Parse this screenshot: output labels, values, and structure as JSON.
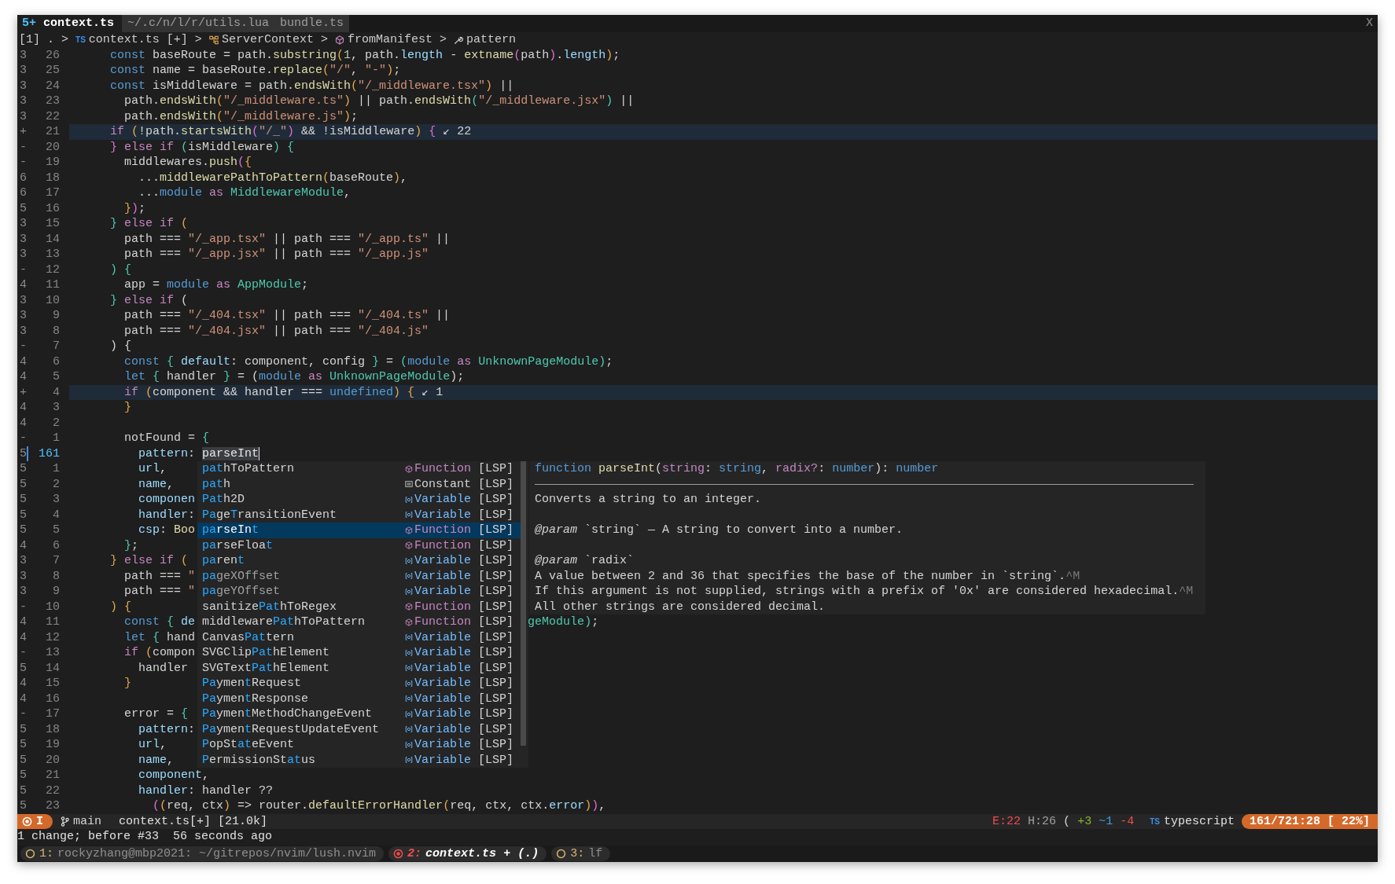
{
  "tabs": [
    {
      "badge": "5+",
      "label": "context.ts",
      "selected": true
    },
    {
      "label": "~/.c/n/l/r/utils.lua",
      "selected": false
    },
    {
      "label": "bundle.ts",
      "selected": false
    }
  ],
  "close_label": "X",
  "breadcrumb": [
    {
      "text": "[1]",
      "kind": "text"
    },
    {
      "text": ".",
      "kind": "text"
    },
    {
      "text": ">",
      "kind": "sep"
    },
    {
      "text": "context.ts [+]",
      "kind": "file",
      "icon_text": "TS"
    },
    {
      "text": ">",
      "kind": "sep"
    },
    {
      "text": "ServerContext",
      "kind": "class"
    },
    {
      "text": ">",
      "kind": "sep"
    },
    {
      "text": "fromManifest",
      "kind": "method"
    },
    {
      "text": ">",
      "kind": "sep"
    },
    {
      "text": "pattern",
      "kind": "property"
    }
  ],
  "editor": {
    "lines": [
      {
        "sign": "3",
        "number": "26",
        "highlighted": false,
        "current": false,
        "code": [
          {
            "text": "    const",
            "kind": "decl"
          },
          {
            "text": " baseRoute = path.",
            "kind": "x"
          },
          {
            "text": "substring",
            "kind": "fn"
          },
          {
            "text": "(",
            "kind": "b1"
          },
          {
            "text": "1",
            "kind": "num"
          },
          {
            "text": ", path.",
            "kind": "x"
          },
          {
            "text": "length",
            "kind": "prop"
          },
          {
            "text": " - ",
            "kind": "x"
          },
          {
            "text": "extname",
            "kind": "fn"
          },
          {
            "text": "(",
            "kind": "b2"
          },
          {
            "text": "path",
            "kind": "x"
          },
          {
            "text": ")",
            "kind": "b2"
          },
          {
            "text": ".",
            "kind": "x"
          },
          {
            "text": "length",
            "kind": "prop"
          },
          {
            "text": ")",
            "kind": "b1"
          },
          {
            "text": ";",
            "kind": "x"
          }
        ]
      },
      {
        "sign": "3",
        "number": "25",
        "highlighted": false,
        "current": false,
        "code": [
          {
            "text": "    const",
            "kind": "decl"
          },
          {
            "text": " name = baseRoute.",
            "kind": "x"
          },
          {
            "text": "replace",
            "kind": "fn"
          },
          {
            "text": "(",
            "kind": "b1"
          },
          {
            "text": "\"/\"",
            "kind": "str"
          },
          {
            "text": ", ",
            "kind": "x"
          },
          {
            "text": "\"-\"",
            "kind": "str"
          },
          {
            "text": ")",
            "kind": "b1"
          },
          {
            "text": ";",
            "kind": "x"
          }
        ]
      },
      {
        "sign": "3",
        "number": "24",
        "highlighted": false,
        "current": false,
        "code": [
          {
            "text": "    const",
            "kind": "decl"
          },
          {
            "text": " isMiddleware = path.",
            "kind": "x"
          },
          {
            "text": "endsWith",
            "kind": "fn"
          },
          {
            "text": "(",
            "kind": "b1"
          },
          {
            "text": "\"/_middleware.tsx\"",
            "kind": "str"
          },
          {
            "text": ")",
            "kind": "b1"
          },
          {
            "text": " ||",
            "kind": "x"
          }
        ]
      },
      {
        "sign": "3",
        "number": "23",
        "highlighted": false,
        "current": false,
        "code": [
          {
            "text": "      path.",
            "kind": "x"
          },
          {
            "text": "endsWith",
            "kind": "fn"
          },
          {
            "text": "(",
            "kind": "b1"
          },
          {
            "text": "\"/_middleware.ts\"",
            "kind": "str"
          },
          {
            "text": ")",
            "kind": "b1"
          },
          {
            "text": " || path.",
            "kind": "x"
          },
          {
            "text": "endsWith",
            "kind": "fn"
          },
          {
            "text": "(",
            "kind": "b3"
          },
          {
            "text": "\"/_middleware.jsx\"",
            "kind": "str"
          },
          {
            "text": ")",
            "kind": "b3"
          },
          {
            "text": " ||",
            "kind": "x"
          }
        ]
      },
      {
        "sign": "3",
        "number": "22",
        "highlighted": false,
        "current": false,
        "code": [
          {
            "text": "      path.",
            "kind": "x"
          },
          {
            "text": "endsWith",
            "kind": "fn"
          },
          {
            "text": "(",
            "kind": "b1"
          },
          {
            "text": "\"/_middleware.js\"",
            "kind": "str"
          },
          {
            "text": ")",
            "kind": "b1"
          },
          {
            "text": ";",
            "kind": "x"
          }
        ]
      },
      {
        "sign": "+",
        "number": "21",
        "highlighted": true,
        "current": false,
        "code": [
          {
            "text": "    if",
            "kind": "kw"
          },
          {
            "text": " (",
            "kind": "b1"
          },
          {
            "text": "!path.",
            "kind": "x"
          },
          {
            "text": "startsWith",
            "kind": "fn"
          },
          {
            "text": "(",
            "kind": "b2"
          },
          {
            "text": "\"/_\"",
            "kind": "str"
          },
          {
            "text": ")",
            "kind": "b2"
          },
          {
            "text": " && !isMiddleware",
            "kind": "x"
          },
          {
            "text": ")",
            "kind": "b1"
          },
          {
            "text": " {",
            "kind": "b2"
          }
        ],
        "virtual_text": "↙ 22"
      },
      {
        "sign": "-",
        "number": "20",
        "highlighted": false,
        "current": false,
        "code": [
          {
            "text": "    }",
            "kind": "b2"
          },
          {
            "text": " else if ",
            "kind": "kw"
          },
          {
            "text": "(",
            "kind": "b3"
          },
          {
            "text": "isMiddleware",
            "kind": "x"
          },
          {
            "text": ")",
            "kind": "b3"
          },
          {
            "text": " {",
            "kind": "b3"
          }
        ]
      },
      {
        "sign": "-",
        "number": "19",
        "highlighted": false,
        "current": false,
        "code": [
          {
            "text": "      middlewares.",
            "kind": "x"
          },
          {
            "text": "push",
            "kind": "fn"
          },
          {
            "text": "(",
            "kind": "b2"
          },
          {
            "text": "{",
            "kind": "b1"
          }
        ]
      },
      {
        "sign": "6",
        "number": "18",
        "highlighted": false,
        "current": false,
        "code": [
          {
            "text": "        ...",
            "kind": "x"
          },
          {
            "text": "middlewarePathToPattern",
            "kind": "fn"
          },
          {
            "text": "(",
            "kind": "b1"
          },
          {
            "text": "baseRoute",
            "kind": "x"
          },
          {
            "text": ")",
            "kind": "b1"
          },
          {
            "text": ",",
            "kind": "x"
          }
        ]
      },
      {
        "sign": "6",
        "number": "17",
        "highlighted": false,
        "current": false,
        "code": [
          {
            "text": "        ...",
            "kind": "x"
          },
          {
            "text": "module",
            "kind": "decl"
          },
          {
            "text": " as ",
            "kind": "kw"
          },
          {
            "text": "MiddlewareModule",
            "kind": "type"
          },
          {
            "text": ",",
            "kind": "x"
          }
        ]
      },
      {
        "sign": "5",
        "number": "16",
        "highlighted": false,
        "current": false,
        "code": [
          {
            "text": "      }",
            "kind": "b1"
          },
          {
            "text": ")",
            "kind": "b2"
          },
          {
            "text": ";",
            "kind": "x"
          }
        ]
      },
      {
        "sign": "3",
        "number": "15",
        "highlighted": false,
        "current": false,
        "code": [
          {
            "text": "    }",
            "kind": "b3"
          },
          {
            "text": " else if ",
            "kind": "kw"
          },
          {
            "text": "(",
            "kind": "b1"
          }
        ]
      },
      {
        "sign": "3",
        "number": "14",
        "highlighted": false,
        "current": false,
        "code": [
          {
            "text": "      path === ",
            "kind": "x"
          },
          {
            "text": "\"/_app.tsx\"",
            "kind": "str"
          },
          {
            "text": " || path === ",
            "kind": "x"
          },
          {
            "text": "\"/_app.ts\"",
            "kind": "str"
          },
          {
            "text": " ||",
            "kind": "x"
          }
        ]
      },
      {
        "sign": "3",
        "number": "13",
        "highlighted": false,
        "current": false,
        "code": [
          {
            "text": "      path === ",
            "kind": "x"
          },
          {
            "text": "\"/_app.jsx\"",
            "kind": "str"
          },
          {
            "text": " || path === ",
            "kind": "x"
          },
          {
            "text": "\"/_app.js\"",
            "kind": "str"
          }
        ]
      },
      {
        "sign": "-",
        "number": "12",
        "highlighted": false,
        "current": false,
        "code": [
          {
            "text": "    )",
            "kind": "b3"
          },
          {
            "text": " {",
            "kind": "b3"
          }
        ]
      },
      {
        "sign": "4",
        "number": "11",
        "highlighted": false,
        "current": false,
        "code": [
          {
            "text": "      app = ",
            "kind": "x"
          },
          {
            "text": "module",
            "kind": "decl"
          },
          {
            "text": " as ",
            "kind": "kw"
          },
          {
            "text": "AppModule",
            "kind": "type"
          },
          {
            "text": ";",
            "kind": "x"
          }
        ]
      },
      {
        "sign": "3",
        "number": "10",
        "highlighted": false,
        "current": false,
        "code": [
          {
            "text": "    }",
            "kind": "b3"
          },
          {
            "text": " else if ",
            "kind": "kw"
          },
          {
            "text": "(",
            "kind": "x"
          }
        ]
      },
      {
        "sign": "3",
        "number": "9",
        "highlighted": false,
        "current": false,
        "code": [
          {
            "text": "      path === ",
            "kind": "x"
          },
          {
            "text": "\"/_404.tsx\"",
            "kind": "str"
          },
          {
            "text": " || path === ",
            "kind": "x"
          },
          {
            "text": "\"/_404.ts\"",
            "kind": "str"
          },
          {
            "text": " ||",
            "kind": "x"
          }
        ]
      },
      {
        "sign": "3",
        "number": "8",
        "highlighted": false,
        "current": false,
        "code": [
          {
            "text": "      path === ",
            "kind": "x"
          },
          {
            "text": "\"/_404.jsx\"",
            "kind": "str"
          },
          {
            "text": " || path === ",
            "kind": "x"
          },
          {
            "text": "\"/_404.js\"",
            "kind": "str"
          }
        ]
      },
      {
        "sign": "-",
        "number": "7",
        "highlighted": false,
        "current": false,
        "code": [
          {
            "text": "    ) {",
            "kind": "x"
          }
        ]
      },
      {
        "sign": "4",
        "number": "6",
        "highlighted": false,
        "current": false,
        "code": [
          {
            "text": "      const",
            "kind": "decl"
          },
          {
            "text": " {",
            "kind": "b3"
          },
          {
            "text": " default",
            "kind": "prop"
          },
          {
            "text": ": component, config ",
            "kind": "x"
          },
          {
            "text": "}",
            "kind": "b3"
          },
          {
            "text": " = ",
            "kind": "x"
          },
          {
            "text": "(",
            "kind": "b3"
          },
          {
            "text": "module",
            "kind": "decl"
          },
          {
            "text": " as ",
            "kind": "kw"
          },
          {
            "text": "UnknownPageModule",
            "kind": "type"
          },
          {
            "text": ")",
            "kind": "b3"
          },
          {
            "text": ";",
            "kind": "x"
          }
        ]
      },
      {
        "sign": "4",
        "number": "5",
        "highlighted": false,
        "current": false,
        "code": [
          {
            "text": "      let",
            "kind": "decl"
          },
          {
            "text": " {",
            "kind": "b3"
          },
          {
            "text": " handler ",
            "kind": "x"
          },
          {
            "text": "}",
            "kind": "b3"
          },
          {
            "text": " = (",
            "kind": "x"
          },
          {
            "text": "module",
            "kind": "decl"
          },
          {
            "text": " as ",
            "kind": "kw"
          },
          {
            "text": "UnknownPageModule",
            "kind": "type"
          },
          {
            "text": ");",
            "kind": "x"
          }
        ]
      },
      {
        "sign": "+",
        "number": "4",
        "highlighted": true,
        "current": false,
        "code": [
          {
            "text": "      if",
            "kind": "kw"
          },
          {
            "text": " (",
            "kind": "b1"
          },
          {
            "text": "component && handler === ",
            "kind": "x"
          },
          {
            "text": "undefined",
            "kind": "decl"
          },
          {
            "text": ")",
            "kind": "b1"
          },
          {
            "text": " {",
            "kind": "b1"
          }
        ],
        "virtual_text": "↙ 1"
      },
      {
        "sign": "4",
        "number": "3",
        "highlighted": false,
        "current": false,
        "code": [
          {
            "text": "      }",
            "kind": "b1"
          }
        ]
      },
      {
        "sign": "4",
        "number": "2",
        "highlighted": false,
        "current": false
      },
      {
        "sign": "-",
        "number": "1",
        "highlighted": false,
        "current": false,
        "code": [
          {
            "text": "      notFound = ",
            "kind": "x"
          },
          {
            "text": "{",
            "kind": "b3"
          }
        ]
      },
      {
        "sign": "5",
        "number": "161",
        "highlighted": false,
        "current": true,
        "code": [
          {
            "text": "        pattern",
            "kind": "prop"
          },
          {
            "text": ": ",
            "kind": "x"
          },
          {
            "text": "parseInt",
            "kind": "hl"
          }
        ]
      },
      {
        "sign": "5",
        "number": "1",
        "highlighted": false,
        "current": false,
        "code": [
          {
            "text": "        url",
            "kind": "prop"
          },
          {
            "text": ",",
            "kind": "x"
          }
        ]
      },
      {
        "sign": "5",
        "number": "2",
        "highlighted": false,
        "current": false,
        "code": [
          {
            "text": "        name",
            "kind": "prop"
          },
          {
            "text": ",",
            "kind": "x"
          }
        ]
      },
      {
        "sign": "5",
        "number": "3",
        "highlighted": false,
        "current": false,
        "code": [
          {
            "text": "        componen",
            "kind": "prop"
          }
        ]
      },
      {
        "sign": "5",
        "number": "4",
        "highlighted": false,
        "current": false,
        "code": [
          {
            "text": "        handler",
            "kind": "prop"
          },
          {
            "text": ":",
            "kind": "x"
          }
        ]
      },
      {
        "sign": "5",
        "number": "5",
        "highlighted": false,
        "current": false,
        "code": [
          {
            "text": "        csp",
            "kind": "prop"
          },
          {
            "text": ": ",
            "kind": "x"
          },
          {
            "text": "Boo",
            "kind": "fn"
          }
        ]
      },
      {
        "sign": "4",
        "number": "6",
        "highlighted": false,
        "current": false,
        "code": [
          {
            "text": "      }",
            "kind": "b3"
          },
          {
            "text": ";",
            "kind": "x"
          }
        ]
      },
      {
        "sign": "3",
        "number": "7",
        "highlighted": false,
        "current": false,
        "code": [
          {
            "text": "    }",
            "kind": "b1"
          },
          {
            "text": " else if ",
            "kind": "kw"
          },
          {
            "text": "(",
            "kind": "b1"
          }
        ]
      },
      {
        "sign": "3",
        "number": "8",
        "highlighted": false,
        "current": false,
        "code": [
          {
            "text": "      path === ",
            "kind": "x"
          },
          {
            "text": "\"",
            "kind": "str"
          }
        ]
      },
      {
        "sign": "3",
        "number": "9",
        "highlighted": false,
        "current": false,
        "code": [
          {
            "text": "      path === ",
            "kind": "x"
          },
          {
            "text": "\"",
            "kind": "str"
          }
        ]
      },
      {
        "sign": "-",
        "number": "10",
        "highlighted": false,
        "current": false,
        "code": [
          {
            "text": "    )",
            "kind": "b1"
          },
          {
            "text": " {",
            "kind": "b1"
          }
        ]
      },
      {
        "sign": "4",
        "number": "11",
        "highlighted": false,
        "current": false,
        "code": [
          {
            "text": "      const",
            "kind": "decl"
          },
          {
            "text": " {",
            "kind": "b3"
          },
          {
            "text": " de",
            "kind": "prop"
          }
        ],
        "tail": [
          {
            "text": "geModule",
            "kind": "type"
          },
          {
            "text": ")",
            "kind": "b3"
          },
          {
            "text": ";",
            "kind": "x"
          }
        ]
      },
      {
        "sign": "4",
        "number": "12",
        "highlighted": false,
        "current": false,
        "code": [
          {
            "text": "      let",
            "kind": "decl"
          },
          {
            "text": " {",
            "kind": "b3"
          },
          {
            "text": " hand",
            "kind": "x"
          }
        ]
      },
      {
        "sign": "-",
        "number": "13",
        "highlighted": false,
        "current": false,
        "code": [
          {
            "text": "      if",
            "kind": "kw"
          },
          {
            "text": " (",
            "kind": "b1"
          },
          {
            "text": "compon",
            "kind": "x"
          }
        ]
      },
      {
        "sign": "5",
        "number": "14",
        "highlighted": false,
        "current": false,
        "code": [
          {
            "text": "        handler",
            "kind": "x"
          }
        ]
      },
      {
        "sign": "4",
        "number": "15",
        "highlighted": false,
        "current": false,
        "code": [
          {
            "text": "      }",
            "kind": "b1"
          }
        ]
      },
      {
        "sign": "4",
        "number": "16",
        "highlighted": false,
        "current": false
      },
      {
        "sign": "-",
        "number": "17",
        "highlighted": false,
        "current": false,
        "code": [
          {
            "text": "      error = ",
            "kind": "x"
          },
          {
            "text": "{",
            "kind": "b3"
          }
        ]
      },
      {
        "sign": "5",
        "number": "18",
        "highlighted": false,
        "current": false,
        "code": [
          {
            "text": "        pattern",
            "kind": "prop"
          },
          {
            "text": ":",
            "kind": "x"
          }
        ]
      },
      {
        "sign": "5",
        "number": "19",
        "highlighted": false,
        "current": false,
        "code": [
          {
            "text": "        url",
            "kind": "prop"
          },
          {
            "text": ",",
            "kind": "x"
          }
        ]
      },
      {
        "sign": "5",
        "number": "20",
        "highlighted": false,
        "current": false,
        "code": [
          {
            "text": "        name",
            "kind": "prop"
          },
          {
            "text": ",",
            "kind": "x"
          }
        ]
      },
      {
        "sign": "5",
        "number": "21",
        "highlighted": false,
        "current": false,
        "code": [
          {
            "text": "        component",
            "kind": "prop"
          },
          {
            "text": ",",
            "kind": "x"
          }
        ]
      },
      {
        "sign": "5",
        "number": "22",
        "highlighted": false,
        "current": false,
        "code": [
          {
            "text": "        handler",
            "kind": "prop"
          },
          {
            "text": ": handler ??",
            "kind": "x"
          }
        ]
      },
      {
        "sign": "5",
        "number": "23",
        "highlighted": false,
        "current": false,
        "code": [
          {
            "text": "          (",
            "kind": "b2"
          },
          {
            "text": "(",
            "kind": "b1"
          },
          {
            "text": "req, ctx",
            "kind": "x"
          },
          {
            "text": ")",
            "kind": "b1"
          },
          {
            "text": " => router.",
            "kind": "x"
          },
          {
            "text": "defaultErrorHandler",
            "kind": "fn"
          },
          {
            "text": "(",
            "kind": "b1"
          },
          {
            "text": "req, ctx, ctx.",
            "kind": "x"
          },
          {
            "text": "error",
            "kind": "prop"
          },
          {
            "text": ")",
            "kind": "b1"
          },
          {
            "text": ")",
            "kind": "b2"
          },
          {
            "text": ",",
            "kind": "x"
          }
        ]
      }
    ],
    "completion": {
      "items": [
        {
          "label": [
            {
              "text": "pat",
              "matched": true
            },
            {
              "text": "hToPattern",
              "matched": false
            }
          ],
          "kind": "function",
          "kind_label": "Function",
          "source": "[LSP]",
          "selected": false,
          "deprecated": false
        },
        {
          "label": [
            {
              "text": "pat",
              "matched": true
            },
            {
              "text": "h",
              "matched": false
            }
          ],
          "kind": "constant",
          "kind_label": "Constant",
          "source": "[LSP]",
          "selected": false,
          "deprecated": false
        },
        {
          "label": [
            {
              "text": "Pat",
              "matched": true
            },
            {
              "text": "h2D",
              "matched": false
            }
          ],
          "kind": "variable",
          "kind_label": "Variable",
          "source": "[LSP]",
          "selected": false,
          "deprecated": false
        },
        {
          "label": [
            {
              "text": "Pa",
              "matched": true
            },
            {
              "text": "ge",
              "matched": false
            },
            {
              "text": "T",
              "matched": true
            },
            {
              "text": "ransitionEvent",
              "matched": false
            }
          ],
          "kind": "variable",
          "kind_label": "Variable",
          "source": "[LSP]",
          "selected": false,
          "deprecated": false
        },
        {
          "label": [
            {
              "text": "pa",
              "matched": true
            },
            {
              "text": "rseIn",
              "matched": false
            },
            {
              "text": "t",
              "matched": true
            }
          ],
          "kind": "function",
          "kind_label": "Function",
          "source": "[LSP]",
          "selected": true,
          "deprecated": false
        },
        {
          "label": [
            {
              "text": "pa",
              "matched": true
            },
            {
              "text": "rseFloa",
              "matched": false
            },
            {
              "text": "t",
              "matched": true
            }
          ],
          "kind": "function",
          "kind_label": "Function",
          "source": "[LSP]",
          "selected": false,
          "deprecated": false
        },
        {
          "label": [
            {
              "text": "pa",
              "matched": true
            },
            {
              "text": "ren",
              "matched": false
            },
            {
              "text": "t",
              "matched": true
            }
          ],
          "kind": "variable",
          "kind_label": "Variable",
          "source": "[LSP]",
          "selected": false,
          "deprecated": false
        },
        {
          "label": [
            {
              "text": "pa",
              "matched": true
            },
            {
              "text": "geXOffset",
              "matched": false
            }
          ],
          "kind": "variable",
          "kind_label": "Variable",
          "source": "[LSP]",
          "selected": false,
          "deprecated": true
        },
        {
          "label": [
            {
              "text": "pa",
              "matched": true
            },
            {
              "text": "geYOffset",
              "matched": false
            }
          ],
          "kind": "variable",
          "kind_label": "Variable",
          "source": "[LSP]",
          "selected": false,
          "deprecated": true
        },
        {
          "label": [
            {
              "text": "sanitize",
              "matched": false
            },
            {
              "text": "Pat",
              "matched": true
            },
            {
              "text": "hToRegex",
              "matched": false
            }
          ],
          "kind": "function",
          "kind_label": "Function",
          "source": "[LSP]",
          "selected": false,
          "deprecated": false
        },
        {
          "label": [
            {
              "text": "middleware",
              "matched": false
            },
            {
              "text": "Pat",
              "matched": true
            },
            {
              "text": "hToPattern",
              "matched": false
            }
          ],
          "kind": "function",
          "kind_label": "Function",
          "source": "[LSP]",
          "selected": false,
          "deprecated": false
        },
        {
          "label": [
            {
              "text": "Canvas",
              "matched": false
            },
            {
              "text": "Pat",
              "matched": true
            },
            {
              "text": "tern",
              "matched": false
            }
          ],
          "kind": "variable",
          "kind_label": "Variable",
          "source": "[LSP]",
          "selected": false,
          "deprecated": false
        },
        {
          "label": [
            {
              "text": "SVGClip",
              "matched": false
            },
            {
              "text": "Pat",
              "matched": true
            },
            {
              "text": "hElement",
              "matched": false
            }
          ],
          "kind": "variable",
          "kind_label": "Variable",
          "source": "[LSP]",
          "selected": false,
          "deprecated": false
        },
        {
          "label": [
            {
              "text": "SVGText",
              "matched": false
            },
            {
              "text": "Pat",
              "matched": true
            },
            {
              "text": "hElement",
              "matched": false
            }
          ],
          "kind": "variable",
          "kind_label": "Variable",
          "source": "[LSP]",
          "selected": false,
          "deprecated": false
        },
        {
          "label": [
            {
              "text": "Pa",
              "matched": true
            },
            {
              "text": "ymen",
              "matched": false
            },
            {
              "text": "t",
              "matched": true
            },
            {
              "text": "Request",
              "matched": false
            }
          ],
          "kind": "variable",
          "kind_label": "Variable",
          "source": "[LSP]",
          "selected": false,
          "deprecated": false
        },
        {
          "label": [
            {
              "text": "Pa",
              "matched": true
            },
            {
              "text": "ymen",
              "matched": false
            },
            {
              "text": "t",
              "matched": true
            },
            {
              "text": "Response",
              "matched": false
            }
          ],
          "kind": "variable",
          "kind_label": "Variable",
          "source": "[LSP]",
          "selected": false,
          "deprecated": false
        },
        {
          "label": [
            {
              "text": "Pa",
              "matched": true
            },
            {
              "text": "ymen",
              "matched": false
            },
            {
              "text": "t",
              "matched": true
            },
            {
              "text": "MethodChangeEvent",
              "matched": false
            }
          ],
          "kind": "variable",
          "kind_label": "Variable",
          "source": "[LSP]",
          "selected": false,
          "deprecated": false
        },
        {
          "label": [
            {
              "text": "Pa",
              "matched": true
            },
            {
              "text": "ymen",
              "matched": false
            },
            {
              "text": "t",
              "matched": true
            },
            {
              "text": "RequestUpdateEvent",
              "matched": false
            }
          ],
          "kind": "variable",
          "kind_label": "Variable",
          "source": "[LSP]",
          "selected": false,
          "deprecated": false
        },
        {
          "label": [
            {
              "text": "P",
              "matched": true
            },
            {
              "text": "opSt",
              "matched": false
            },
            {
              "text": "at",
              "matched": true
            },
            {
              "text": "eEvent",
              "matched": false
            }
          ],
          "kind": "variable",
          "kind_label": "Variable",
          "source": "[LSP]",
          "selected": false,
          "deprecated": false
        },
        {
          "label": [
            {
              "text": "P",
              "matched": true
            },
            {
              "text": "ermissionSt",
              "matched": false
            },
            {
              "text": "at",
              "matched": true
            },
            {
              "text": "us",
              "matched": false
            }
          ],
          "kind": "variable",
          "kind_label": "Variable",
          "source": "[LSP]",
          "selected": false,
          "deprecated": false
        }
      ]
    },
    "documentation": {
      "signature": [
        {
          "text": "function",
          "kind": "decl"
        },
        {
          "text": " parseInt",
          "kind": "fn"
        },
        {
          "text": "(",
          "kind": "x"
        },
        {
          "text": "string",
          "kind": "kw"
        },
        {
          "text": ": ",
          "kind": "x"
        },
        {
          "text": "string",
          "kind": "decl"
        },
        {
          "text": ", ",
          "kind": "x"
        },
        {
          "text": "radix?",
          "kind": "kw"
        },
        {
          "text": ": ",
          "kind": "x"
        },
        {
          "text": "number",
          "kind": "decl"
        },
        {
          "text": "): ",
          "kind": "x"
        },
        {
          "text": "number",
          "kind": "decl"
        }
      ],
      "blocks": [
        [
          {
            "text": "Converts a string to an integer."
          }
        ],
        [
          {
            "text": "*@param* `string` — A string to convert into a number."
          }
        ],
        [
          {
            "text": "*@param* `radix`"
          },
          {
            "text": "A value between 2 and 36 that specifies the base of the number in `string`.",
            "suffix": "^M"
          },
          {
            "text": "If this argument is not supplied, strings with a prefix of '0x' are considered hexadecimal.",
            "suffix": "^M"
          },
          {
            "text": "All other strings are considered decimal."
          }
        ]
      ]
    }
  },
  "status_line": {
    "mode": "I",
    "branch": "main",
    "file": "context.ts[+] [21.0k]",
    "diagnostics": [
      {
        "text": "E:22",
        "kind": "error"
      },
      {
        "text": "H:26",
        "kind": "hint"
      }
    ],
    "git_glyph": "(",
    "diff": [
      {
        "text": "+3",
        "kind": "added"
      },
      {
        "text": "~1",
        "kind": "changed"
      },
      {
        "text": "-4",
        "kind": "removed"
      }
    ],
    "filetype": {
      "icon_text": "TS",
      "label": "typescript"
    },
    "position": "161/721:28 [ 22%]"
  },
  "message": "1 change; before #33  56 seconds ago",
  "tmux": {
    "windows": [
      {
        "number": "1:",
        "title": "rockyzhang@mbp2021: ~/gitrepos/nvim/lush.nvim",
        "selected": false
      },
      {
        "number": "2:",
        "title": "context.ts + (.)",
        "selected": true
      },
      {
        "number": "3:",
        "title": "lf",
        "selected": false
      }
    ]
  }
}
